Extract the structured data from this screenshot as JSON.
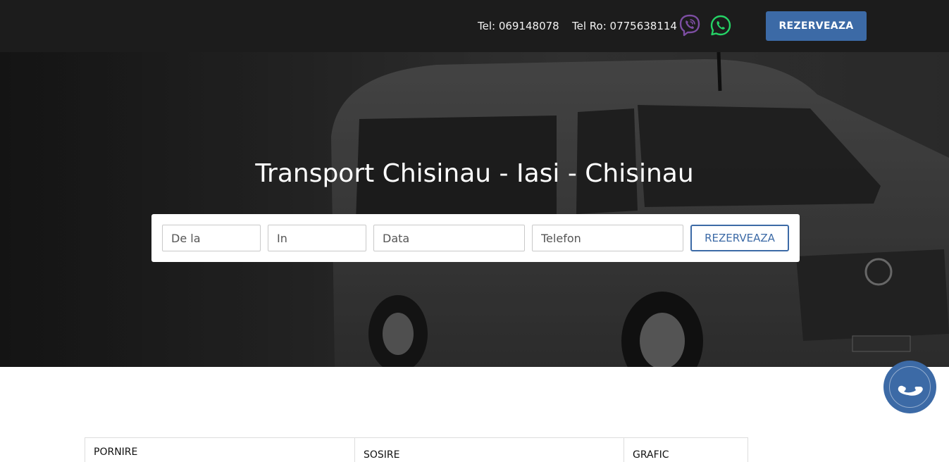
{
  "header": {
    "phone_md": "Tel: 069148078",
    "phone_ro": "Tel Ro: 0775638114",
    "viber_icon": "viber-icon",
    "whatsapp_icon": "whatsapp-icon",
    "cta_label": "REZERVEAZA"
  },
  "hero": {
    "title": "Transport Chisinau - Iasi - Chisinau"
  },
  "booking_form": {
    "from_placeholder": "De la",
    "to_placeholder": "In",
    "date_placeholder": "Data",
    "phone_placeholder": "Telefon",
    "submit_label": "REZERVEAZA"
  },
  "call_button": {
    "icon": "phone-icon"
  },
  "schedule_table": {
    "headers": [
      "PORNIRE",
      "SOSIRE",
      "GRAFIC"
    ]
  },
  "colors": {
    "accent": "#3c6aa6",
    "topbar": "#1c1c1c",
    "viber": "#7d4ea3",
    "whatsapp": "#25d366"
  }
}
